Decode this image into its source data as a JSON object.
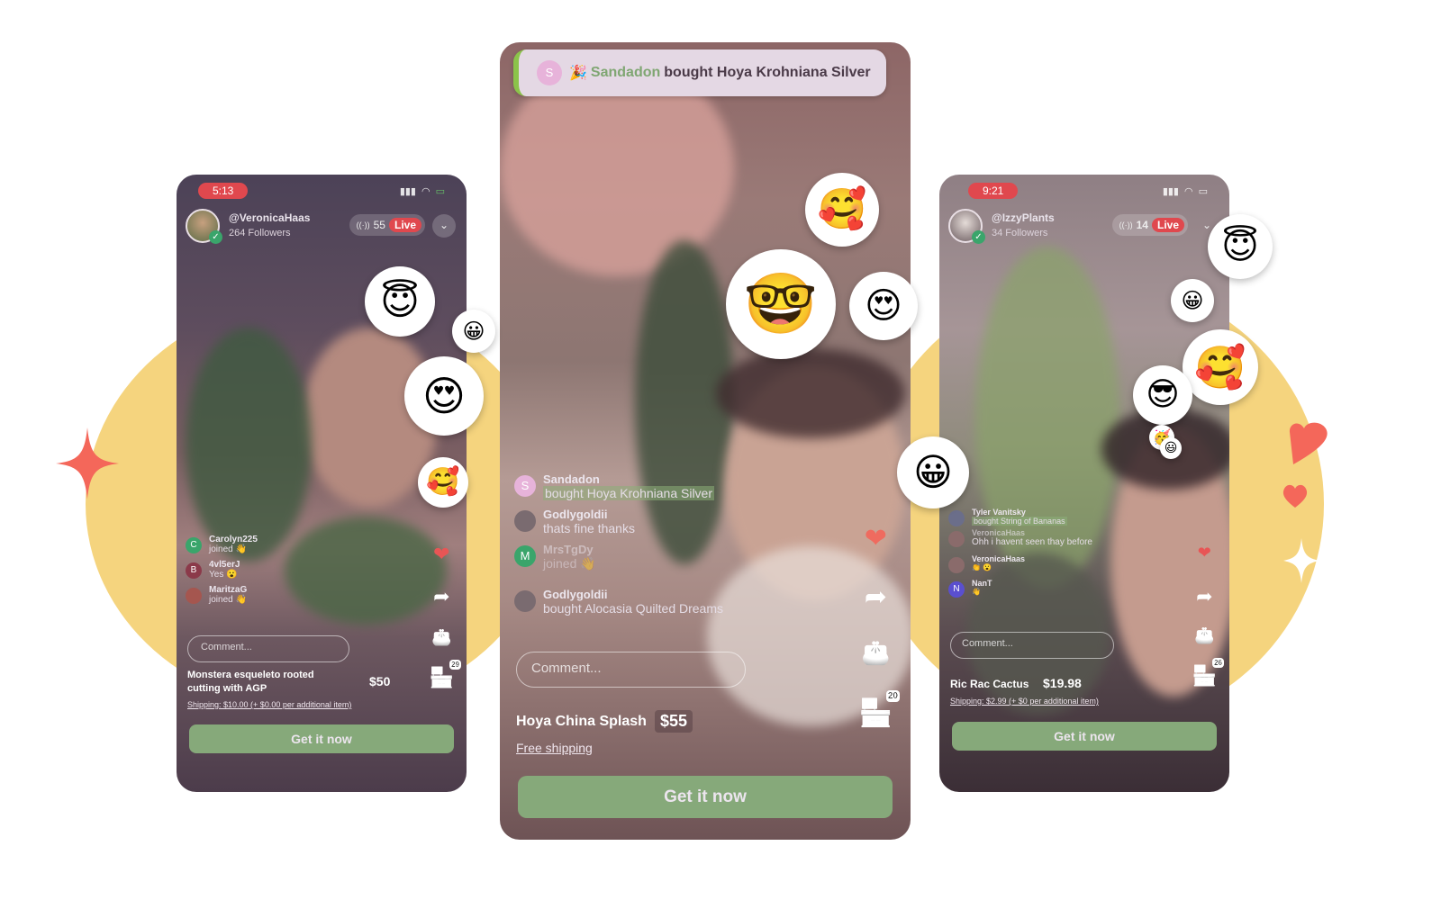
{
  "colors": {
    "accent_green": "#86a97a",
    "live_red": "#e0484e",
    "blob_yellow": "#f5d47e",
    "coral": "#f4675a"
  },
  "phones": {
    "left": {
      "status_time": "5:13",
      "host_name": "@VeronicaHaas",
      "host_followers": "264 Followers",
      "viewer_count": "55",
      "live_label": "Live",
      "chat": [
        {
          "avatar": "C",
          "avatar_color": "#3aa56b",
          "user": "Carolyn225",
          "msg": "joined 👋"
        },
        {
          "avatar": "B",
          "avatar_color": "#8b3a4a",
          "user": "4vl5erJ",
          "msg": "Yes 😮"
        },
        {
          "avatar": "",
          "avatar_color": "#a5564f",
          "user": "MaritzaG",
          "msg": "joined 👋"
        }
      ],
      "comment_placeholder": "Comment...",
      "product_title": "Monstera esqueleto rooted cutting with AGP",
      "product_price": "$50",
      "shipping": "Shipping: $10.00 (+ $0.00 per additional item)",
      "shop_badge": "29",
      "cta_label": "Get it now"
    },
    "center": {
      "toast": {
        "avatar": "S",
        "emoji": "🎉",
        "user": "Sandadon",
        "text": "bought Hoya Krohniana Silver"
      },
      "chat": [
        {
          "avatar": "S",
          "avatar_color": "#e7b3da",
          "user": "Sandadon",
          "msg": "bought Hoya Krohniana Silver",
          "highlight": true
        },
        {
          "avatar": "",
          "avatar_color": "#7a6b70",
          "user": "Godlygoldii",
          "msg": "thats fine thanks"
        },
        {
          "avatar": "M",
          "avatar_color": "#3aa56b",
          "user": "MrsTgDy",
          "msg": "joined 👋"
        },
        {
          "avatar": "",
          "avatar_color": "#7a6b70",
          "user": "Godlygoldii",
          "msg": "bought Alocasia Quilted Dreams"
        }
      ],
      "comment_placeholder": "Comment...",
      "product_title": "Hoya China Splash",
      "product_price": "$55",
      "shipping": "Free shipping",
      "shop_badge": "20",
      "cta_label": "Get it now"
    },
    "right": {
      "status_time": "9:21",
      "host_name": "@IzzyPlants",
      "host_followers": "34 Followers",
      "viewer_count": "14",
      "live_label": "Live",
      "chat": [
        {
          "avatar": "",
          "avatar_color": "#6b6e8a",
          "user": "Tyler Vanitsky",
          "msg": "bought String of Bananas",
          "highlight": true
        },
        {
          "avatar": "",
          "avatar_color": "#8a6b6b",
          "user": "VeronicaHaas",
          "msg": "Ohh i havent seen thay before"
        },
        {
          "avatar": "",
          "avatar_color": "#8a6b6b",
          "user": "VeronicaHaas",
          "msg": "👏 😮"
        },
        {
          "avatar": "N",
          "avatar_color": "#5a4fcf",
          "user": "NanT",
          "msg": "👋"
        }
      ],
      "comment_placeholder": "Comment...",
      "product_title": "Ric Rac Cactus",
      "product_price": "$19.98",
      "shipping": "Shipping: $2.99 (+ $0 per additional item)",
      "shop_badge": "26",
      "cta_label": "Get it now"
    }
  },
  "icons": {
    "broadcast": "((·))",
    "chevron": "⌄",
    "check": "✓",
    "heart": "❤",
    "share": "➦",
    "wallet": "👛",
    "shop": "🏪",
    "signal": "▮▮▮",
    "wifi": "◠",
    "battery": "▭"
  },
  "reactions": {
    "halo": "😇",
    "grin": "😀",
    "heart_eyes": "😍",
    "hearts": "🥰",
    "nerd": "🤓",
    "cool": "😎",
    "party": "🥳",
    "smile": "😃"
  }
}
